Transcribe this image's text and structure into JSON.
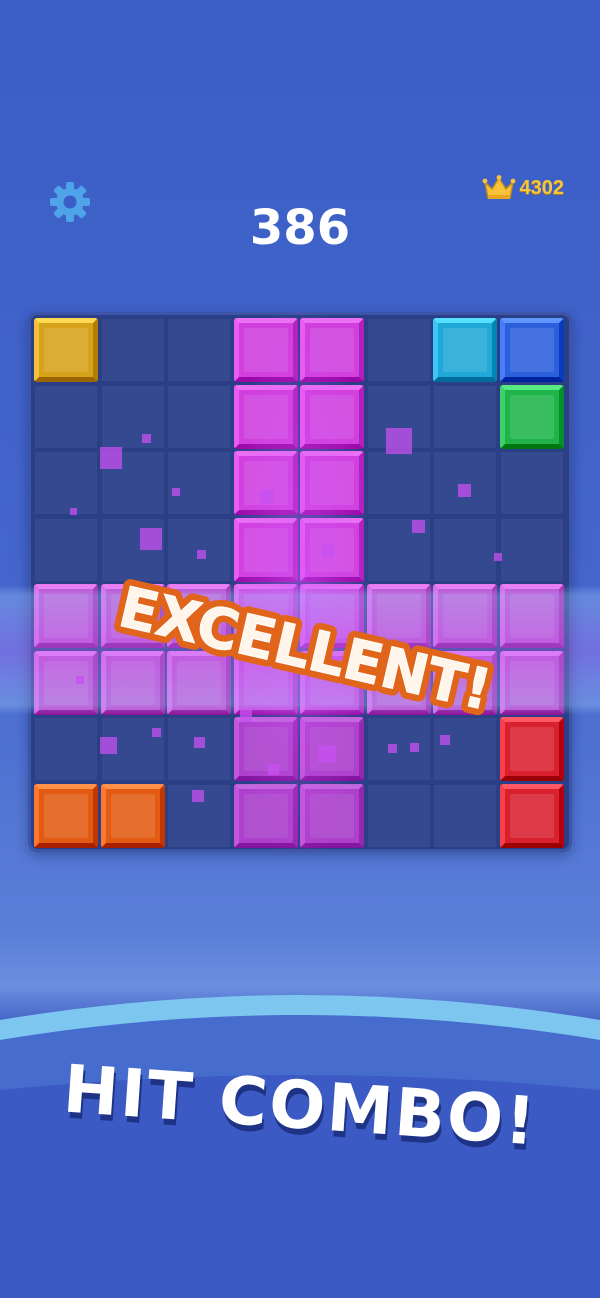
{
  "header": {
    "score": "386",
    "best_score": "4302",
    "settings_icon": "gear-icon",
    "best_icon": "crown-icon"
  },
  "banner": {
    "excellent_text": "EXCELLENT!",
    "hit_combo_text": "HIT COMBO!"
  },
  "board": {
    "rows": 8,
    "cols": 8,
    "colors": {
      "yellow": "#d6a21a",
      "cyan": "#1fa8d8",
      "blue": "#2b5fdc",
      "green": "#1fb34a",
      "magenta": "#e23ee6",
      "pink": "#d54ad8",
      "red": "#d8202e",
      "orange": "#e35a12"
    },
    "blocks": [
      {
        "row": 0,
        "col": 0,
        "color": "yellow"
      },
      {
        "row": 0,
        "col": 3,
        "color": "magenta"
      },
      {
        "row": 0,
        "col": 4,
        "color": "magenta"
      },
      {
        "row": 0,
        "col": 6,
        "color": "cyan"
      },
      {
        "row": 0,
        "col": 7,
        "color": "blue"
      },
      {
        "row": 1,
        "col": 3,
        "color": "magenta"
      },
      {
        "row": 1,
        "col": 4,
        "color": "magenta"
      },
      {
        "row": 1,
        "col": 7,
        "color": "green"
      },
      {
        "row": 2,
        "col": 3,
        "color": "magenta"
      },
      {
        "row": 2,
        "col": 4,
        "color": "magenta"
      },
      {
        "row": 3,
        "col": 3,
        "color": "magenta"
      },
      {
        "row": 3,
        "col": 4,
        "color": "magenta"
      },
      {
        "row": 4,
        "col": 0,
        "color": "pink"
      },
      {
        "row": 4,
        "col": 1,
        "color": "pink"
      },
      {
        "row": 4,
        "col": 2,
        "color": "pink"
      },
      {
        "row": 4,
        "col": 3,
        "color": "magenta"
      },
      {
        "row": 4,
        "col": 4,
        "color": "magenta"
      },
      {
        "row": 4,
        "col": 5,
        "color": "pink"
      },
      {
        "row": 4,
        "col": 6,
        "color": "pink"
      },
      {
        "row": 4,
        "col": 7,
        "color": "pink"
      },
      {
        "row": 5,
        "col": 0,
        "color": "pink"
      },
      {
        "row": 5,
        "col": 1,
        "color": "pink"
      },
      {
        "row": 5,
        "col": 2,
        "color": "pink"
      },
      {
        "row": 5,
        "col": 3,
        "color": "magenta"
      },
      {
        "row": 5,
        "col": 4,
        "color": "magenta"
      },
      {
        "row": 5,
        "col": 5,
        "color": "pink"
      },
      {
        "row": 5,
        "col": 6,
        "color": "pink"
      },
      {
        "row": 5,
        "col": 7,
        "color": "pink"
      },
      {
        "row": 6,
        "col": 3,
        "color": "magenta"
      },
      {
        "row": 6,
        "col": 4,
        "color": "magenta"
      },
      {
        "row": 6,
        "col": 7,
        "color": "red"
      },
      {
        "row": 7,
        "col": 0,
        "color": "orange"
      },
      {
        "row": 7,
        "col": 1,
        "color": "orange"
      },
      {
        "row": 7,
        "col": 3,
        "color": "magenta"
      },
      {
        "row": 7,
        "col": 4,
        "color": "magenta"
      },
      {
        "row": 7,
        "col": 7,
        "color": "red"
      }
    ]
  }
}
